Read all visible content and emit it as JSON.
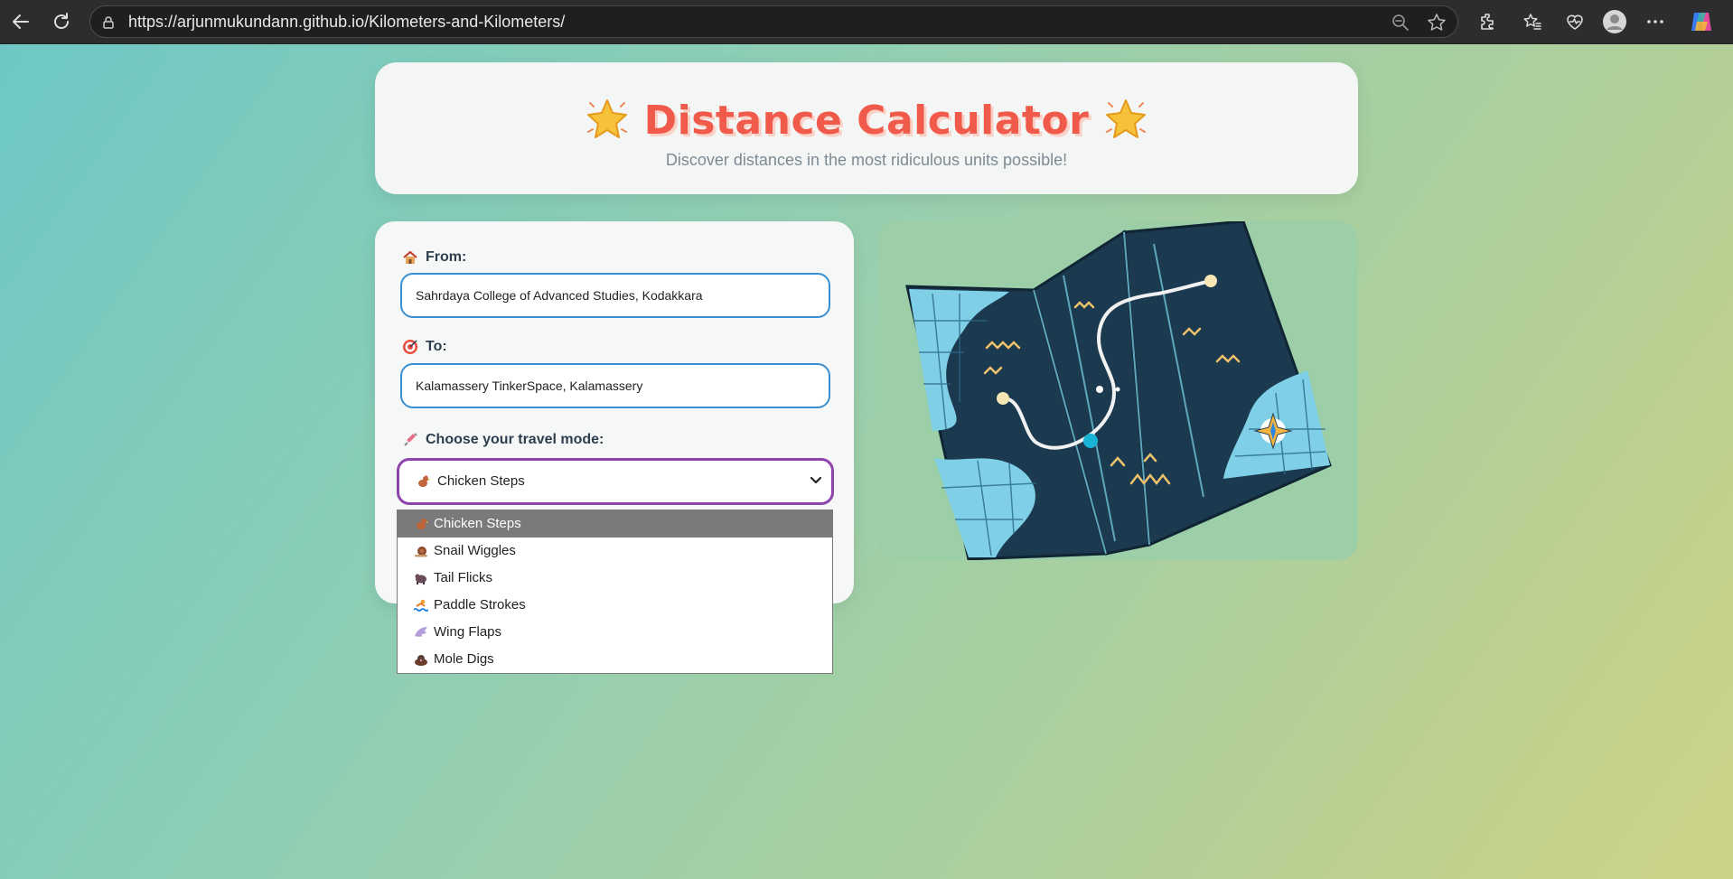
{
  "browser": {
    "url": "https://arjunmukundann.github.io/Kilometers-and-Kilometers/"
  },
  "header": {
    "title": "Distance Calculator",
    "subtitle": "Discover distances in the most ridiculous units possible!"
  },
  "form": {
    "from_label": "From:",
    "from_value": "Sahrdaya College of Advanced Studies, Kodakkara",
    "to_label": "To:",
    "to_value": "Kalamassery TinkerSpace, Kalamassery",
    "mode_label": "Choose your travel mode:",
    "mode_selected": "Chicken Steps"
  },
  "dropdown": {
    "options": [
      {
        "label": "Chicken Steps",
        "icon": "chicken-icon"
      },
      {
        "label": "Snail Wiggles",
        "icon": "snail-icon"
      },
      {
        "label": "Tail Flicks",
        "icon": "beaver-icon"
      },
      {
        "label": "Paddle Strokes",
        "icon": "swimmer-icon"
      },
      {
        "label": "Wing Flaps",
        "icon": "wing-icon"
      },
      {
        "label": "Mole Digs",
        "icon": "mole-icon"
      }
    ]
  },
  "colors": {
    "title": "#ef5a4b",
    "input_border": "#3a8fd0",
    "select_border": "#8e44ad",
    "map_dark": "#1b3a4f",
    "map_water": "#7fd0e6"
  }
}
